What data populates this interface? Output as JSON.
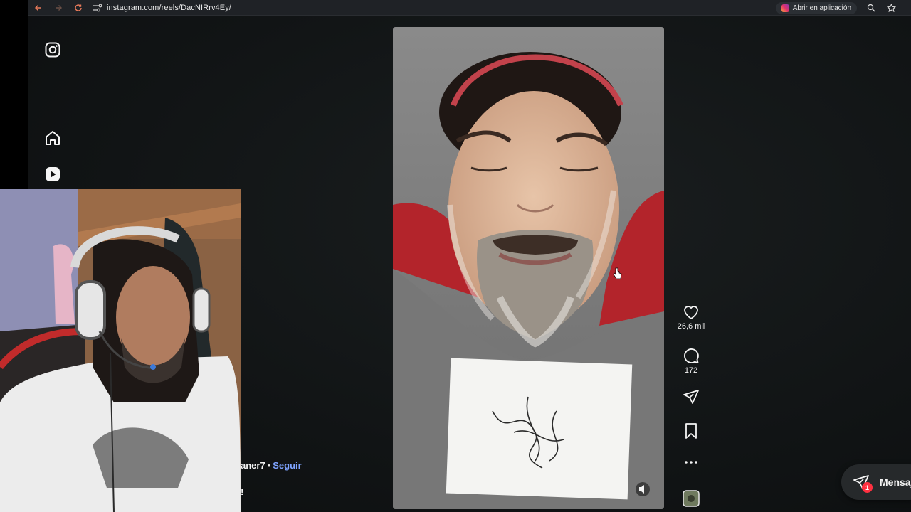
{
  "browser": {
    "url": "instagram.com/reels/DacNIRrv4Ey/",
    "open_app_label": "Abrir en aplicación"
  },
  "sidebar": {
    "items": [
      {
        "name": "instagram-logo-icon"
      },
      {
        "name": "home-icon"
      },
      {
        "name": "reels-icon"
      }
    ]
  },
  "reel": {
    "actions": {
      "likes": "26,6 mil",
      "comments": "172"
    },
    "caption": {
      "username_partial": "aner7",
      "separator": "•",
      "follow_label": "Seguir",
      "text_partial": "!"
    }
  },
  "messages": {
    "label": "Mensaj",
    "badge": "1"
  },
  "colors": {
    "follow_link": "#7ea3ff",
    "badge": "#ff3040",
    "background": "#111415"
  }
}
